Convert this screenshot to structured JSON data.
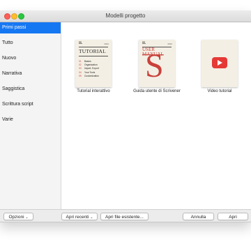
{
  "window": {
    "title": "Modelli progetto"
  },
  "sidebar": {
    "items": [
      {
        "label": "Primi passi",
        "selected": true
      },
      {
        "label": "Tutto"
      },
      {
        "label": "Nuovo"
      },
      {
        "label": "Narrativa"
      },
      {
        "label": "Saggistica"
      },
      {
        "label": "Scrittura script"
      },
      {
        "label": "Varie"
      }
    ]
  },
  "templates": [
    {
      "label": "Tutorial interattivo",
      "thumb": {
        "roman": "II.",
        "year": "2022",
        "heading": "TUTORIAL",
        "toc": [
          {
            "n": "01",
            "t": "Basics"
          },
          {
            "n": "02",
            "t": "Organization"
          },
          {
            "n": "03",
            "t": "Import, Export"
          },
          {
            "n": "04",
            "t": "Your Tools"
          },
          {
            "n": "05",
            "t": "Customization"
          }
        ]
      }
    },
    {
      "label": "Guida utente di Scrivener",
      "thumb": {
        "roman": "II.",
        "year": "2022",
        "heading_line1": "USER",
        "heading_line2": "MANUAL",
        "glyph": "S"
      }
    },
    {
      "label": "Video tutorial",
      "thumb": {
        "icon": "play-icon"
      }
    }
  ],
  "footer": {
    "options_label": "Opzioni",
    "recent_label": "Apri recenti",
    "open_existing_label": "Apri file esistente...",
    "cancel_label": "Annulla",
    "open_label": "Apri"
  },
  "colors": {
    "selection": "#1677f3",
    "accent_red": "#c9413b",
    "youtube_red": "#e53935"
  }
}
